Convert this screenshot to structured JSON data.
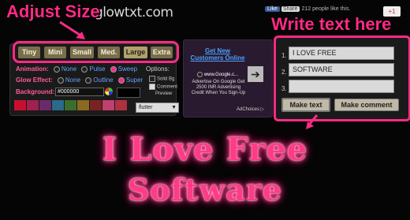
{
  "header": {
    "logo": "glowtxt.com",
    "like_label": "Like",
    "share_label": "Share",
    "like_count_text": "212 people like this.",
    "gplus_label": "+1"
  },
  "callouts": {
    "adjust_size": "Adjust Size",
    "write_text": "Write text here"
  },
  "size_options": [
    "Tiny",
    "Mini",
    "Small",
    "Med.",
    "Large",
    "Extra"
  ],
  "size_selected": "Large",
  "options": {
    "animation_label": "Animation:",
    "animation_values": [
      "None",
      "Pulse",
      "Sweep"
    ],
    "animation_selected": "Sweep",
    "glow_label": "Glow Effect:",
    "glow_values": [
      "None",
      "Outline",
      "Super"
    ],
    "glow_selected": "Super",
    "options_label": "Options:",
    "option_solid_bg": "Solid Bg",
    "option_comment": "Comment",
    "option_preview": "Preview",
    "background_label": "Background:",
    "background_value": "#000000",
    "font_select": "flutter",
    "swatch_colors": [
      "#c8102e",
      "#a02050",
      "#6a2a6a",
      "#2b6a8a",
      "#3a6e2e",
      "#8a6a1e",
      "#7a2222",
      "#c04070",
      "#b03040"
    ]
  },
  "ad": {
    "title": "Get New Customers Online",
    "url": "www.Google.c...",
    "body": "Advertise On Google Get 2500 INR Advertising Credit When You Sign-Up",
    "adchoices": "AdChoices ▷",
    "arrow": "➔"
  },
  "text_inputs": {
    "line_numbers": [
      "1.",
      "2.",
      "3."
    ],
    "values": [
      "I LOVE FREE",
      "SOFTWARE",
      ""
    ],
    "make_text": "Make text",
    "make_comment": "Make comment"
  },
  "output": {
    "line1": "I Love Free",
    "line2": "Software"
  },
  "colors": {
    "accent": "#ff2a85",
    "glow": "#ff3b86",
    "button": "#b2a06b"
  }
}
